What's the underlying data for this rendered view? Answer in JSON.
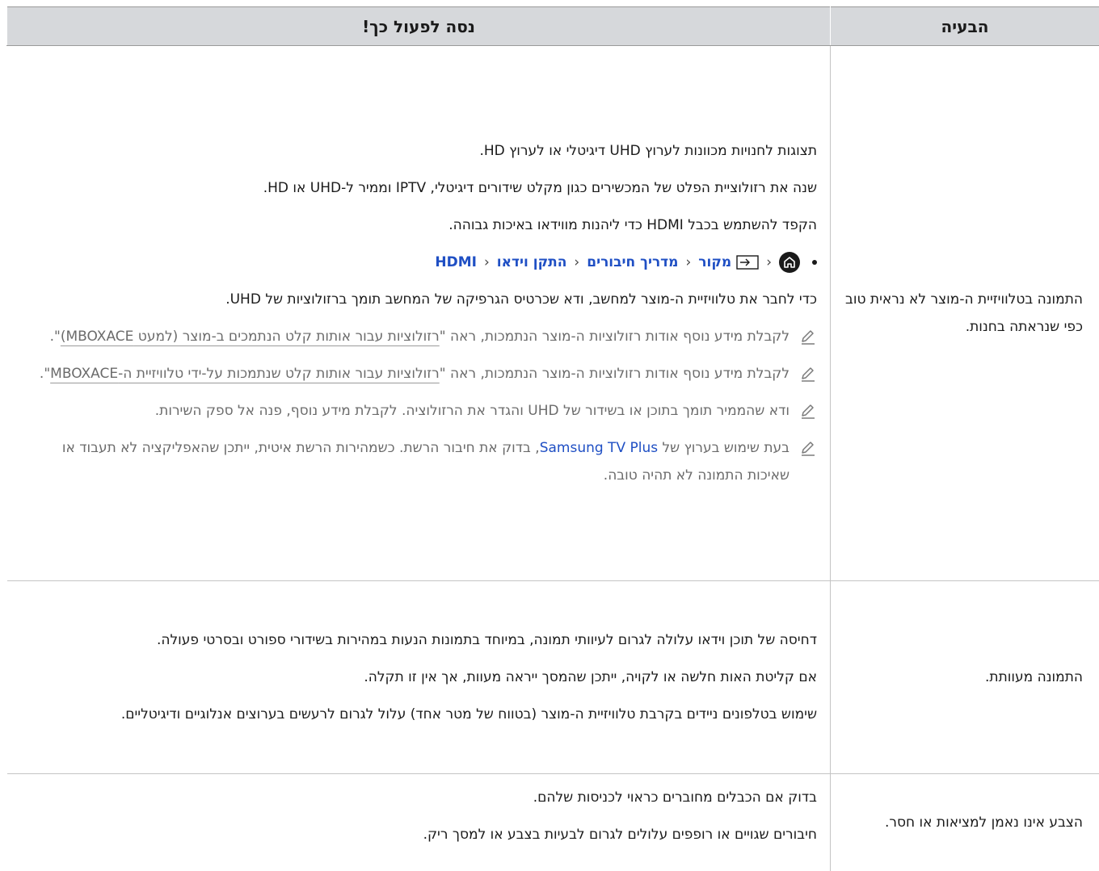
{
  "header": {
    "problem": "הבעיה",
    "solution": "נסה לפעול כך!"
  },
  "rows": [
    {
      "problem": "התמונה בטלוויזיית ה-מוצר לא נראית טוב כפי שנראתה בחנות.",
      "paras": [
        "תצוגות לחנויות מכוונות לערוץ UHD דיגיטלי או לערוץ HD.",
        "שנה את רזולוציית הפלט של המכשירים כגון מקלט שידורים דיגיטלי, IPTV וממיר ל-UHD או HD.",
        "הקפד להשתמש בכבל HDMI כדי ליהנות מווידאו באיכות גבוהה."
      ],
      "path": [
        "מקור",
        "מדריך חיבורים",
        "התקן וידאו",
        "HDMI"
      ],
      "para_after_path": "כדי לחבר את טלוויזיית ה-מוצר למחשב, ודא שכרטיס הגרפיקה של המחשב תומך ברזולוציות של UHD.",
      "notes": [
        {
          "before": "לקבלת מידע נוסף אודות רזולוציות ה-מוצר הנתמכות, ראה \"",
          "link": "רזולוציות עבור אותות קלט הנתמכים ב-מוצר (למעט MBOXACE)",
          "after": "\"."
        },
        {
          "before": "לקבלת מידע נוסף אודות רזולוציות ה-מוצר הנתמכות, ראה \"",
          "link": "רזולוציות עבור אותות קלט שנתמכות על-ידי טלוויזיית ה-MBOXACE",
          "after": "\"."
        },
        {
          "before": "ודא שהממיר תומך בתוכן או בשידור של UHD והגדר את הרזולוציה. לקבלת מידע נוסף, פנה אל ספק השירות.",
          "link": "",
          "after": ""
        },
        {
          "before": "בעת שימוש בערוץ של ",
          "ui": "Samsung TV Plus",
          "after": ", בדוק את חיבור הרשת. כשמהירות הרשת איטית, ייתכן שהאפליקציה לא תעבוד או שאיכות התמונה לא תהיה טובה."
        }
      ]
    },
    {
      "problem": "התמונה מעוותת.",
      "paras": [
        "דחיסה של תוכן וידאו עלולה לגרום לעיוותי תמונה, במיוחד בתמונות הנעות במהירות בשידורי ספורט ובסרטי פעולה.",
        "אם קליטת האות חלשה או לקויה, ייתכן שהמסך ייראה מעוות, אך אין זו תקלה.",
        "שימוש בטלפונים ניידים בקרבת טלוויזיית ה-מוצר (בטווח של מטר אחד) עלול לגרום לרעשים בערוצים אנלוגיים ודיגיטליים."
      ]
    },
    {
      "problem": "הצבע אינו נאמן למציאות או חסר.",
      "paras": [
        "בדוק אם הכבלים מחוברים כראוי לכניסות שלהם.",
        "חיבורים שגויים או רופפים עלולים לגרום לבעיות בצבע או למסך ריק."
      ]
    }
  ]
}
